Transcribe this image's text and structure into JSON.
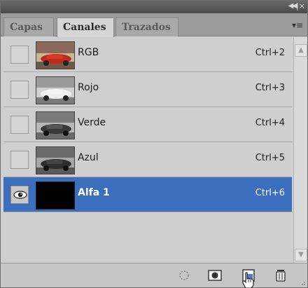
{
  "titlebar": {
    "collapse_icon": "double-chevron-left-icon",
    "close_icon": "close-icon"
  },
  "tabs": [
    {
      "label": "Capas",
      "active": false
    },
    {
      "label": "Canales",
      "active": true
    },
    {
      "label": "Trazados",
      "active": false
    }
  ],
  "panel_menu_icon": "panel-menu-icon",
  "channels": [
    {
      "name": "RGB",
      "shortcut": "Ctrl+2",
      "visible": false,
      "selected": false,
      "thumb": "color"
    },
    {
      "name": "Rojo",
      "shortcut": "Ctrl+3",
      "visible": false,
      "selected": false,
      "thumb": "gray-light"
    },
    {
      "name": "Verde",
      "shortcut": "Ctrl+4",
      "visible": false,
      "selected": false,
      "thumb": "gray-mid"
    },
    {
      "name": "Azul",
      "shortcut": "Ctrl+5",
      "visible": false,
      "selected": false,
      "thumb": "gray-dark"
    },
    {
      "name": "Alfa 1",
      "shortcut": "Ctrl+6",
      "visible": true,
      "selected": true,
      "thumb": "black"
    }
  ],
  "toolbar": {
    "buttons": [
      "load-selection-icon",
      "save-selection-icon",
      "new-channel-icon",
      "trash-icon"
    ]
  },
  "colors": {
    "selection": "#3b6fbd",
    "panel_bg": "#cfcfcf"
  }
}
